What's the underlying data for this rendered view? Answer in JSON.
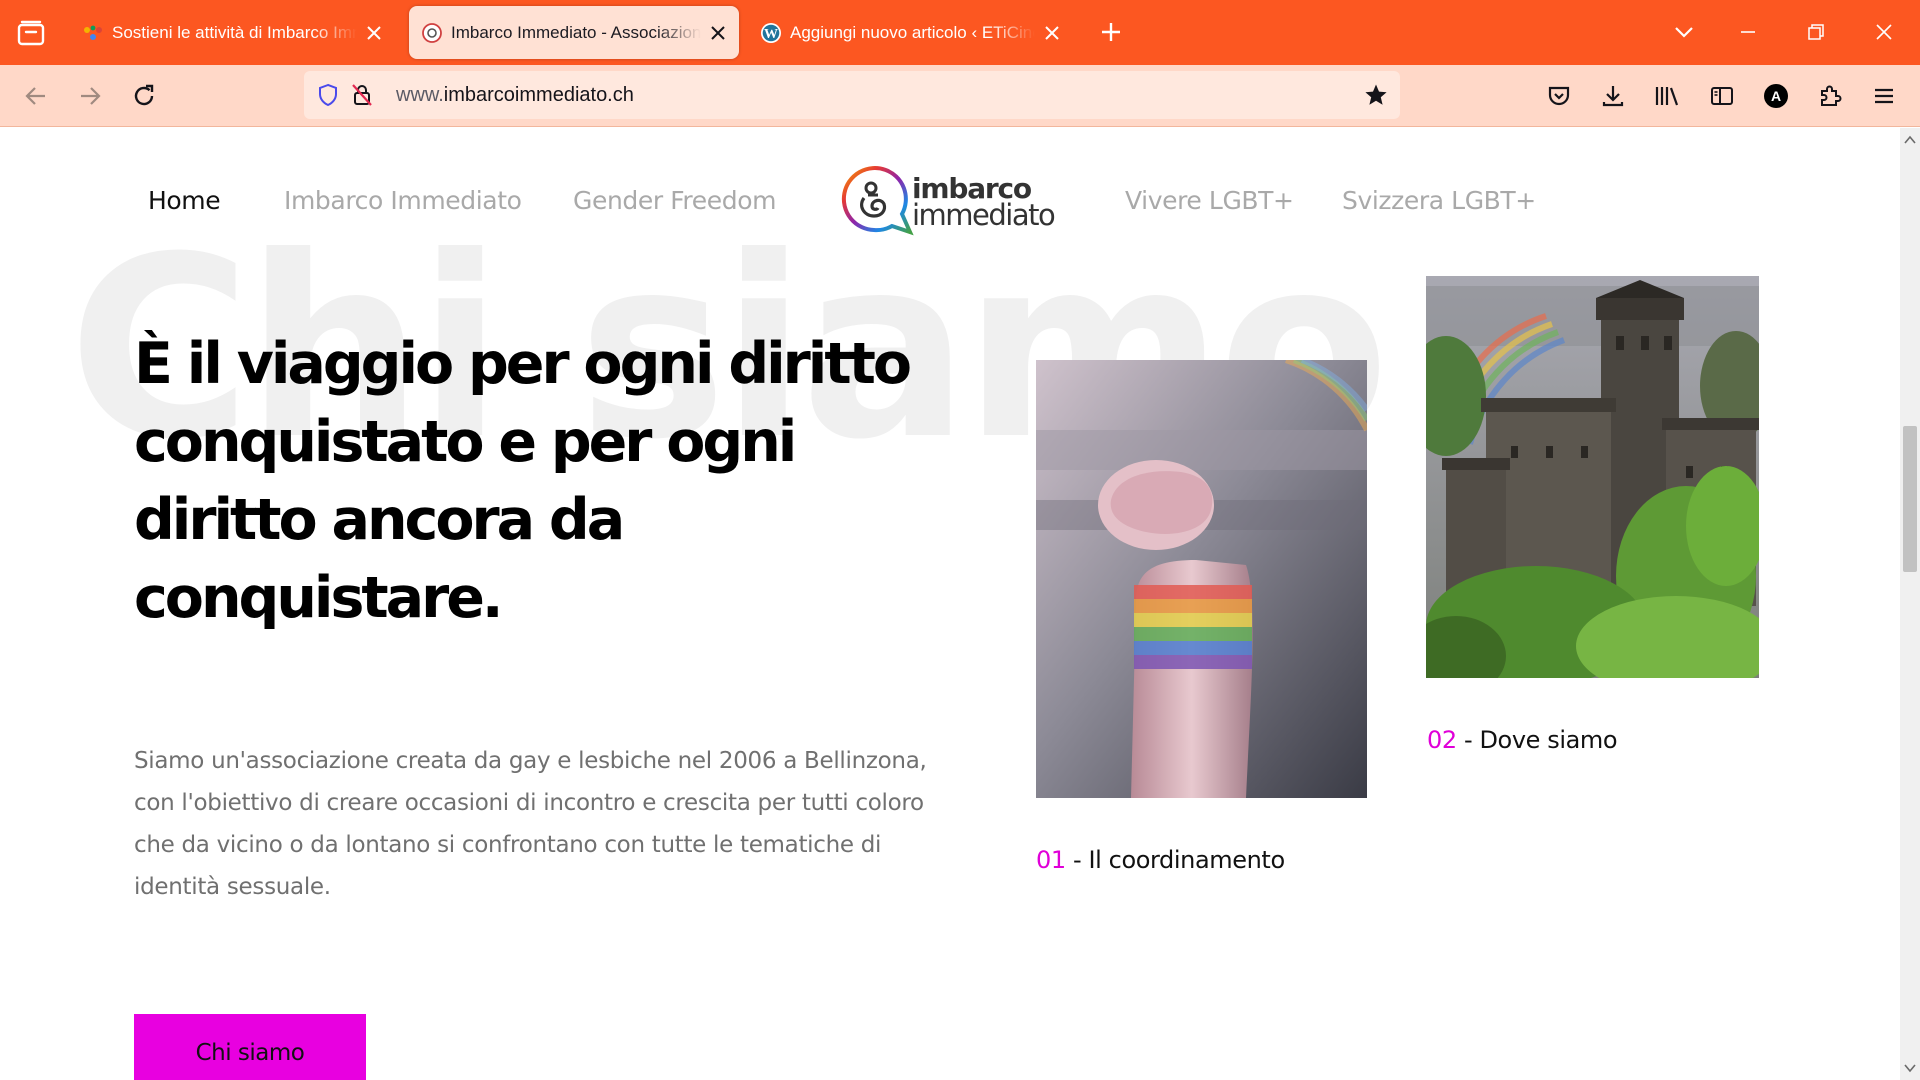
{
  "browser": {
    "tabs": [
      {
        "title": "Sostieni le attività di Imbarco Immediato",
        "active": false,
        "favicon": "multicolor-brand-icon"
      },
      {
        "title": "Imbarco Immediato - Associazione LGBT+",
        "active": true,
        "favicon": "imbarco-logo-icon"
      },
      {
        "title": "Aggiungi nuovo articolo ‹ ETiCinese",
        "active": false,
        "favicon": "wordpress-icon"
      }
    ],
    "url_prefix": "www.",
    "url_domain": "imbarcoimmediato.ch",
    "profile_initial": "A",
    "accent_color": "#fc5721"
  },
  "site": {
    "nav": {
      "home": "Home",
      "imbarco": "Imbarco Immediato",
      "gender": "Gender Freedom",
      "vivere": "Vivere LGBT+",
      "svizzera": "Svizzera LGBT+"
    },
    "logo": {
      "line1": "imbarco",
      "line2": "immediato"
    },
    "background_word": "Chi siamo",
    "headline": "È il viaggio per ogni diritto conquistato e per ogni diritto ancora da conquistare.",
    "intro": "Siamo un'associazione creata da gay e lesbiche nel 2006 a Bellinzona, con l'obiettivo di creare occasioni di incontro e crescita per tutti coloro che da vicino o da lontano si confrontano con tutte le tematiche di identità sessuale.",
    "cta_label": "Chi siamo",
    "cards": [
      {
        "number": "01",
        "separator": " - ",
        "label": "Il coordinamento"
      },
      {
        "number": "02",
        "separator": " - ",
        "label": "Dove siamo"
      }
    ],
    "accent_color": "#e800e0"
  }
}
